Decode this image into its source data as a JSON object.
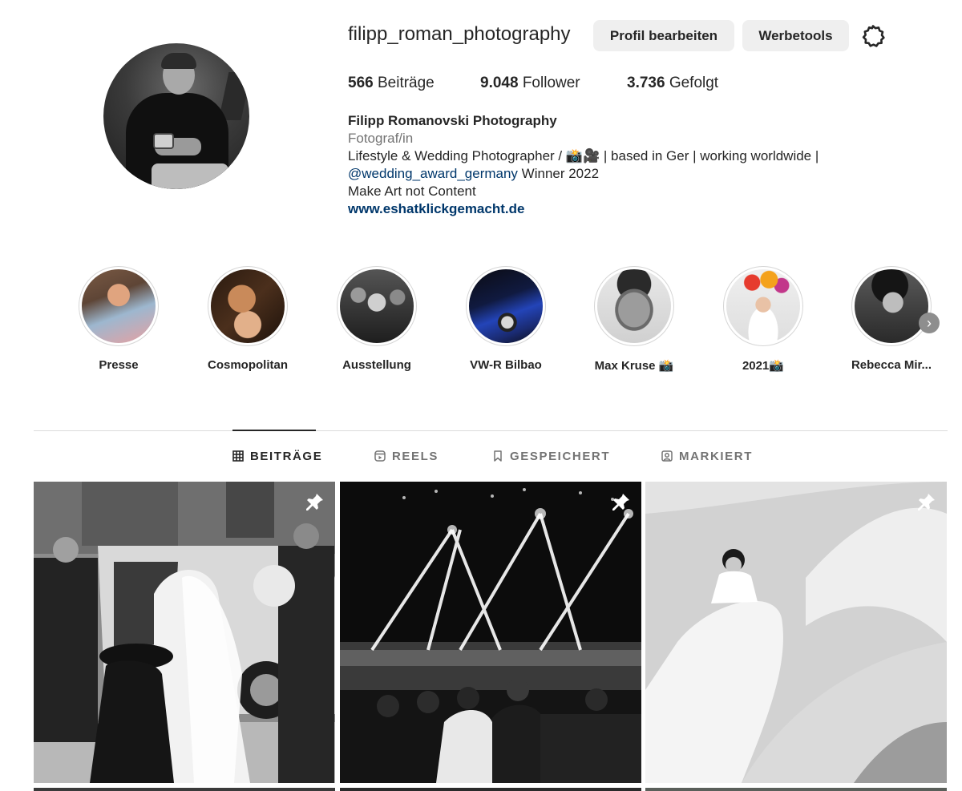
{
  "profile": {
    "username": "filipp_roman_photography",
    "edit_profile_label": "Profil bearbeiten",
    "ad_tools_label": "Werbetools",
    "settings_icon": "gear-icon",
    "stats": {
      "posts_count": "566",
      "posts_label": "Beiträge",
      "followers_count": "9.048",
      "followers_label": "Follower",
      "following_count": "3.736",
      "following_label": "Gefolgt"
    },
    "bio": {
      "name": "Filipp Romanovski Photography",
      "category": "Fotograf/in",
      "line1": "Lifestyle & Wedding Photographer / 📸🎥 | based in Ger | working worldwide |",
      "mention": "@wedding_award_germany",
      "line2_rest": " Winner 2022",
      "line3": "Make Art not Content",
      "website": "www.eshatklickgemacht.de"
    }
  },
  "highlights": [
    {
      "label": "Presse"
    },
    {
      "label": "Cosmopolitan"
    },
    {
      "label": "Ausstellung"
    },
    {
      "label": "VW-R Bilbao"
    },
    {
      "label": "Max Kruse 📸"
    },
    {
      "label": "2021📸"
    },
    {
      "label": "Rebecca Mir..."
    }
  ],
  "tabs": [
    {
      "label": "BEITRÄGE",
      "icon": "grid-icon",
      "active": true
    },
    {
      "label": "REELS",
      "icon": "reels-icon",
      "active": false
    },
    {
      "label": "GESPEICHERT",
      "icon": "bookmark-icon",
      "active": false
    },
    {
      "label": "MARKIERT",
      "icon": "tagged-icon",
      "active": false
    }
  ],
  "posts": [
    {
      "pinned": true,
      "subject": "wedding-car"
    },
    {
      "pinned": true,
      "subject": "fireworks"
    },
    {
      "pinned": true,
      "subject": "studio-portrait"
    }
  ],
  "colors": {
    "link": "#00376b",
    "button_bg": "#efefef",
    "text": "#262626",
    "muted": "#737373"
  }
}
